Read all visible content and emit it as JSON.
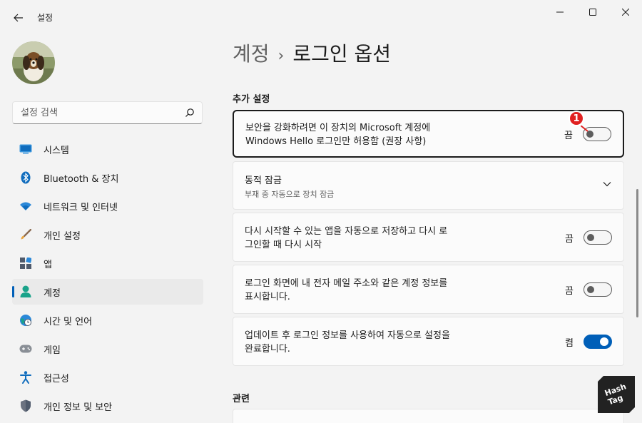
{
  "app": {
    "title": "설정"
  },
  "search": {
    "placeholder": "설정 검색"
  },
  "sidebar": {
    "items": [
      {
        "label": "시스템",
        "icon": "system-icon"
      },
      {
        "label": "Bluetooth & 장치",
        "icon": "bluetooth-icon"
      },
      {
        "label": "네트워크 및 인터넷",
        "icon": "wifi-icon"
      },
      {
        "label": "개인 설정",
        "icon": "brush-icon"
      },
      {
        "label": "앱",
        "icon": "apps-icon"
      },
      {
        "label": "계정",
        "icon": "account-icon",
        "active": true
      },
      {
        "label": "시간 및 언어",
        "icon": "globe-clock-icon"
      },
      {
        "label": "게임",
        "icon": "gamepad-icon"
      },
      {
        "label": "접근성",
        "icon": "accessibility-icon"
      },
      {
        "label": "개인 정보 및 보안",
        "icon": "shield-icon"
      }
    ]
  },
  "breadcrumb": {
    "parent": "계정",
    "separator": "›",
    "current": "로그인 옵션"
  },
  "sections": {
    "additional": "추가 설정",
    "related": "관련"
  },
  "settings": [
    {
      "line1": "보안을 강화하려면 이 장치의 Microsoft 계정에",
      "line2": "Windows Hello 로그인만 허용함 (권장 사항)",
      "state_label": "끔",
      "on": false
    },
    {
      "title": "동적 잠금",
      "subtitle": "부재 중 자동으로 장치 잠금"
    },
    {
      "line1": "다시 시작할 수 있는 앱을 자동으로 저장하고 다시 로",
      "line2": "그인할 때 다시 시작",
      "state_label": "끔",
      "on": false
    },
    {
      "line1": "로그인 화면에 내 전자 메일 주소와 같은 계정 정보를",
      "line2": "표시합니다.",
      "state_label": "끔",
      "on": false
    },
    {
      "line1": "업데이트 후 로그인 정보를 사용하여 자동으로 설정을",
      "line2": "완료합니다.",
      "state_label": "켬",
      "on": true
    }
  ],
  "annotation": {
    "badge_number": "1"
  },
  "watermark": {
    "text_line1": "Hash",
    "text_line2": "Tag"
  },
  "colors": {
    "accent": "#005fb8",
    "badge": "#e02020",
    "background": "#f3f3f3",
    "card": "#fbfbfb"
  }
}
